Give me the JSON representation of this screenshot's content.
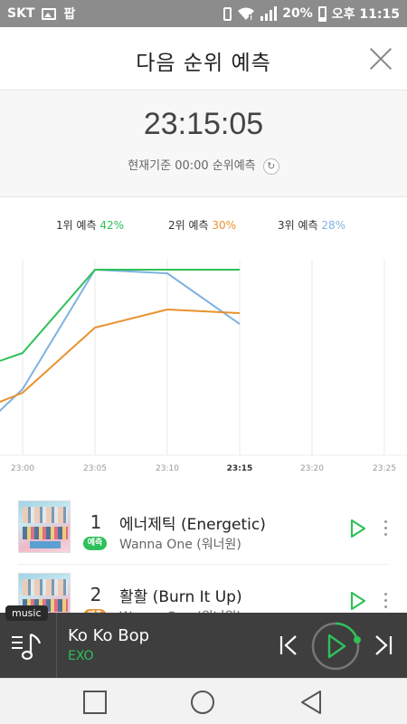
{
  "status_bar": {
    "carrier": "SKT",
    "app_badge": "팝",
    "battery": "20%",
    "time": "오후 11:15"
  },
  "header": {
    "title": "다음 순위 예측"
  },
  "timer": {
    "value": "23:15:05",
    "caption": "현재기준 00:00 순위예측"
  },
  "legend": [
    {
      "label": "1위 예측",
      "value": "42%",
      "color": "#2ec05a"
    },
    {
      "label": "2위 예측",
      "value": "30%",
      "color": "#e8922e"
    },
    {
      "label": "3위 예측",
      "value": "28%",
      "color": "#7fb2e0"
    }
  ],
  "chart_data": {
    "type": "line",
    "x": [
      "23:00",
      "23:05",
      "23:10",
      "23:15",
      "23:20",
      "23:25"
    ],
    "xlabel": "",
    "ylabel": "",
    "grid": true,
    "series": [
      {
        "name": "1위 예측",
        "color": "#2ec05a",
        "x": [
          22.0,
          23.0,
          23.05,
          23.1,
          23.15
        ],
        "values": [
          0.23,
          0.3,
          0.53,
          0.53,
          0.53
        ]
      },
      {
        "name": "2위 예측",
        "color": "#e8922e",
        "x": [
          22.0,
          23.0,
          23.05,
          23.1,
          23.15
        ],
        "values": [
          0.11,
          0.19,
          0.37,
          0.42,
          0.41
        ]
      },
      {
        "name": "3위 예측",
        "color": "#7fb2e0",
        "x": [
          22.0,
          23.0,
          23.05,
          23.1,
          23.15
        ],
        "values": [
          0.01,
          0.2,
          0.53,
          0.52,
          0.38
        ]
      }
    ]
  },
  "songs": [
    {
      "rank": "1",
      "badge": "예측",
      "title": "에너제틱 (Energetic)",
      "artist": "Wanna One (워너원)"
    },
    {
      "rank": "2",
      "badge": "예측",
      "title": "활활 (Burn It Up)",
      "artist": "Wanna One (워너원)"
    }
  ],
  "player": {
    "tag": "music",
    "title": "Ko Ko Bop",
    "artist": "EXO"
  },
  "icons": {
    "close": "close-icon",
    "refresh": "refresh-icon",
    "play": "play-icon",
    "more": "more-vertical-icon",
    "prev": "skip-previous-icon",
    "next": "skip-next-icon",
    "menu": "playlist-icon"
  }
}
